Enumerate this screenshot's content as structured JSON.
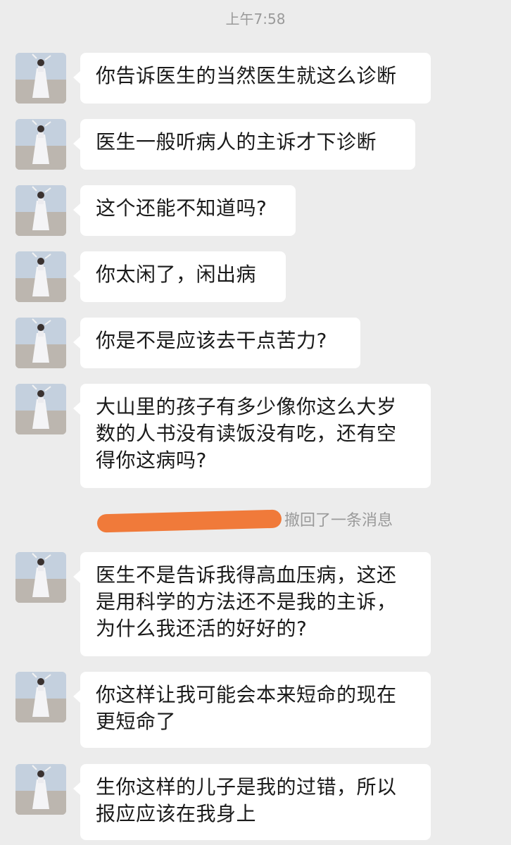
{
  "status": {
    "time": "上午7:58"
  },
  "messages": [
    {
      "text": "你告诉医生的当然医生就这么诊断"
    },
    {
      "text": "医生一般听病人的主诉才下诊断"
    },
    {
      "text": "这个还能不知道吗?"
    },
    {
      "text": "你太闲了，闲出病"
    },
    {
      "text": "你是不是应该去干点苦力?"
    },
    {
      "text": "大山里的孩子有多少像你这么大岁\n数的人书没有读饭没有吃，还有空\n得你这病吗?"
    },
    {
      "text": "医生不是告诉我得高血压病，这还\n是用科学的方法还不是我的主诉，\n为什么我还活的好好的?"
    },
    {
      "text": "你这样让我可能会本来短命的现在\n更短命了"
    },
    {
      "text": "生你这样的儿子是我的过错，所以\n报应应该在我身上"
    }
  ],
  "system_notice": {
    "text": "撤回了一条消息"
  },
  "colors": {
    "background": "#ececec",
    "bubble": "#ffffff",
    "redaction": "#f07a3a"
  }
}
